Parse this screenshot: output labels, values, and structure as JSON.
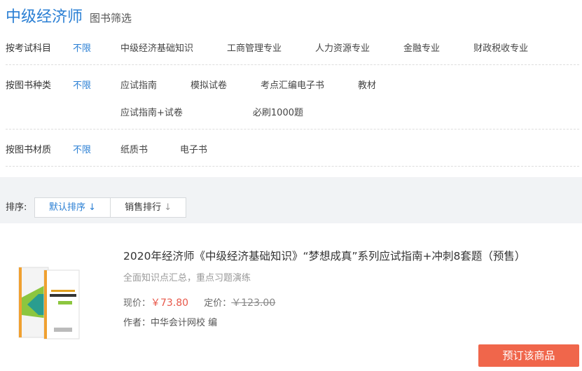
{
  "header": {
    "title": "中级经济师",
    "subtitle": "图书筛选"
  },
  "filters": [
    {
      "label": "按考试科目",
      "any": "不限",
      "options": [
        "中级经济基础知识",
        "工商管理专业",
        "人力资源专业",
        "金融专业",
        "财政税收专业"
      ]
    },
    {
      "label": "按图书种类",
      "any": "不限",
      "options": [
        "应试指南",
        "模拟试卷",
        "考点汇编电子书",
        "教材",
        "应试指南+试卷",
        "必刷1000题"
      ]
    },
    {
      "label": "按图书材质",
      "any": "不限",
      "options": [
        "纸质书",
        "电子书"
      ]
    }
  ],
  "sort": {
    "label": "排序:",
    "options": [
      "默认排序",
      "销售排行"
    ],
    "arrow": "↓"
  },
  "product": {
    "title": "2020年经济师《中级经济基础知识》“梦想成真”系列应试指南+冲刺8套题（预售）",
    "desc": "全面知识点汇总，重点习题演练",
    "price_label": "现价：",
    "price": "￥73.80",
    "list_label": "定价：",
    "list_price": "￥123.00",
    "author": "作者：中华会计网校 编",
    "button": "预订该商品"
  },
  "colors": {
    "accent": "#2a7fd4",
    "buy": "#f0664b",
    "price": "#e8584a"
  }
}
